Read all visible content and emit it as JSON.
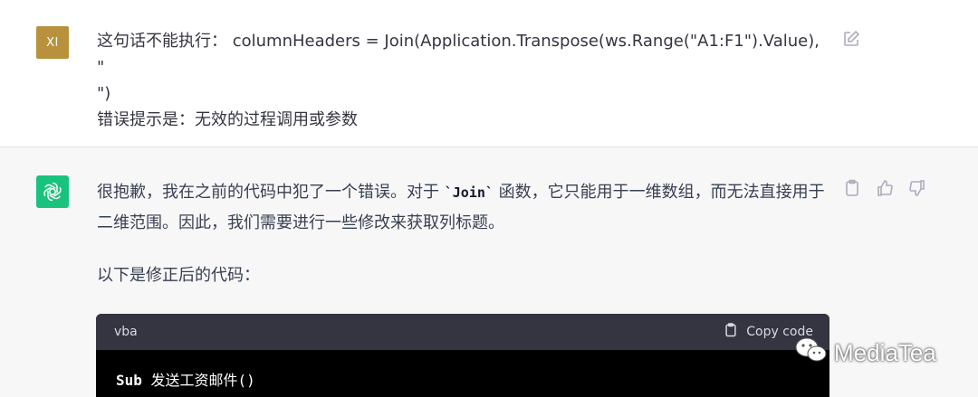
{
  "user": {
    "avatar_initials": "XI",
    "avatar_color": "#b8913c",
    "line1": "这句话不能执行： columnHeaders = Join(Application.Transpose(ws.Range(\"A1:F1\").Value), \"",
    "line2": "\")",
    "line3": "错误提示是：无效的过程调用或参数",
    "edit_icon": "edit-icon"
  },
  "assistant": {
    "avatar_color": "#19c37d",
    "avatar_icon": "openai-logo-icon",
    "para1_before": "很抱歉，我在之前的代码中犯了一个错误。对于 ",
    "para1_code": "`Join`",
    "para1_after": " 函数，它只能用于一维数组，而无法直接用于二维范围。因此，我们需要进行一些修改来获取列标题。",
    "para2": "以下是修正后的代码：",
    "actions": [
      "clipboard-icon",
      "thumbs-up-icon",
      "thumbs-down-icon"
    ]
  },
  "codeblock": {
    "language": "vba",
    "copy_label": "Copy code",
    "line1_keyword": "Sub",
    "line1_rest": " 发送工资邮件()"
  },
  "watermark": {
    "text": "MediaTea",
    "icon": "wechat-icon"
  }
}
